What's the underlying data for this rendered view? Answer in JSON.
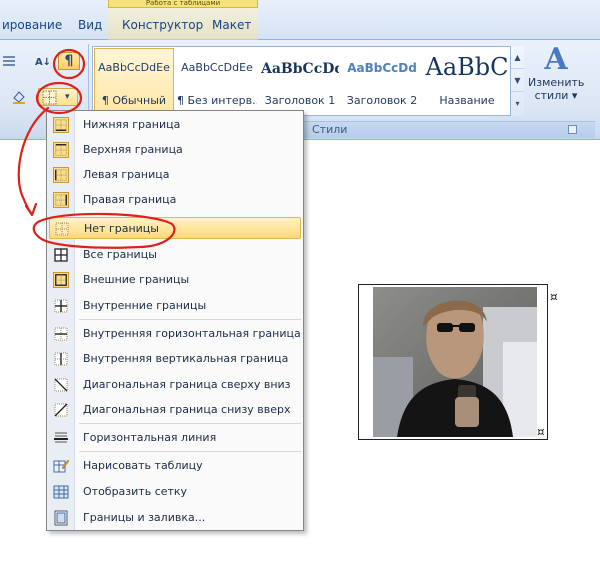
{
  "tabs": {
    "contextual_header": "Работа с таблицами",
    "items": [
      {
        "label": "ирование"
      },
      {
        "label": "Вид"
      },
      {
        "label": "Конструктор"
      },
      {
        "label": "Макет"
      }
    ]
  },
  "styles_group": {
    "label": "Стили",
    "items": [
      {
        "sample": "AaBbCcDdEe",
        "name": "¶ Обычный",
        "selected": true
      },
      {
        "sample": "AaBbCcDdEe",
        "name": "¶ Без интерв..."
      },
      {
        "sample": "AaBbCcDd",
        "name": "Заголовок 1"
      },
      {
        "sample": "AaBbCcDd",
        "name": "Заголовок 2"
      },
      {
        "sample": "AaBbC",
        "name": "Название"
      }
    ],
    "change_styles": {
      "line1": "Изменить",
      "line2": "стили ▾"
    }
  },
  "toolbar": {
    "pilcrow": "¶",
    "sort": "A↓",
    "borders_arrow": "▾"
  },
  "borders_menu": {
    "items": [
      {
        "label": "Нижняя граница",
        "icon": "bottom-border-icon"
      },
      {
        "label": "Верхняя граница",
        "icon": "top-border-icon"
      },
      {
        "label": "Левая граница",
        "icon": "left-border-icon"
      },
      {
        "label": "Правая граница",
        "icon": "right-border-icon"
      },
      {
        "label": "Нет границы",
        "icon": "no-border-icon",
        "highlighted": true
      },
      {
        "label": "Все границы",
        "icon": "all-borders-icon"
      },
      {
        "label": "Внешние границы",
        "icon": "outside-borders-icon"
      },
      {
        "label": "Внутренние границы",
        "icon": "inside-borders-icon"
      },
      {
        "label": "Внутренняя горизонтальная граница",
        "icon": "inside-horizontal-border-icon"
      },
      {
        "label": "Внутренняя вертикальная граница",
        "icon": "inside-vertical-border-icon"
      },
      {
        "label": "Диагональная граница сверху вниз",
        "icon": "diagonal-down-border-icon"
      },
      {
        "label": "Диагональная граница снизу вверх",
        "icon": "diagonal-up-border-icon"
      },
      {
        "label": "Горизонтальная линия",
        "icon": "horizontal-line-icon"
      },
      {
        "label": "Нарисовать таблицу",
        "icon": "draw-table-icon"
      },
      {
        "label": "Отобразить сетку",
        "icon": "view-gridlines-icon"
      },
      {
        "label": "Границы и заливка...",
        "icon": "borders-shading-icon"
      }
    ]
  },
  "document": {
    "cell_marker": "¤"
  }
}
